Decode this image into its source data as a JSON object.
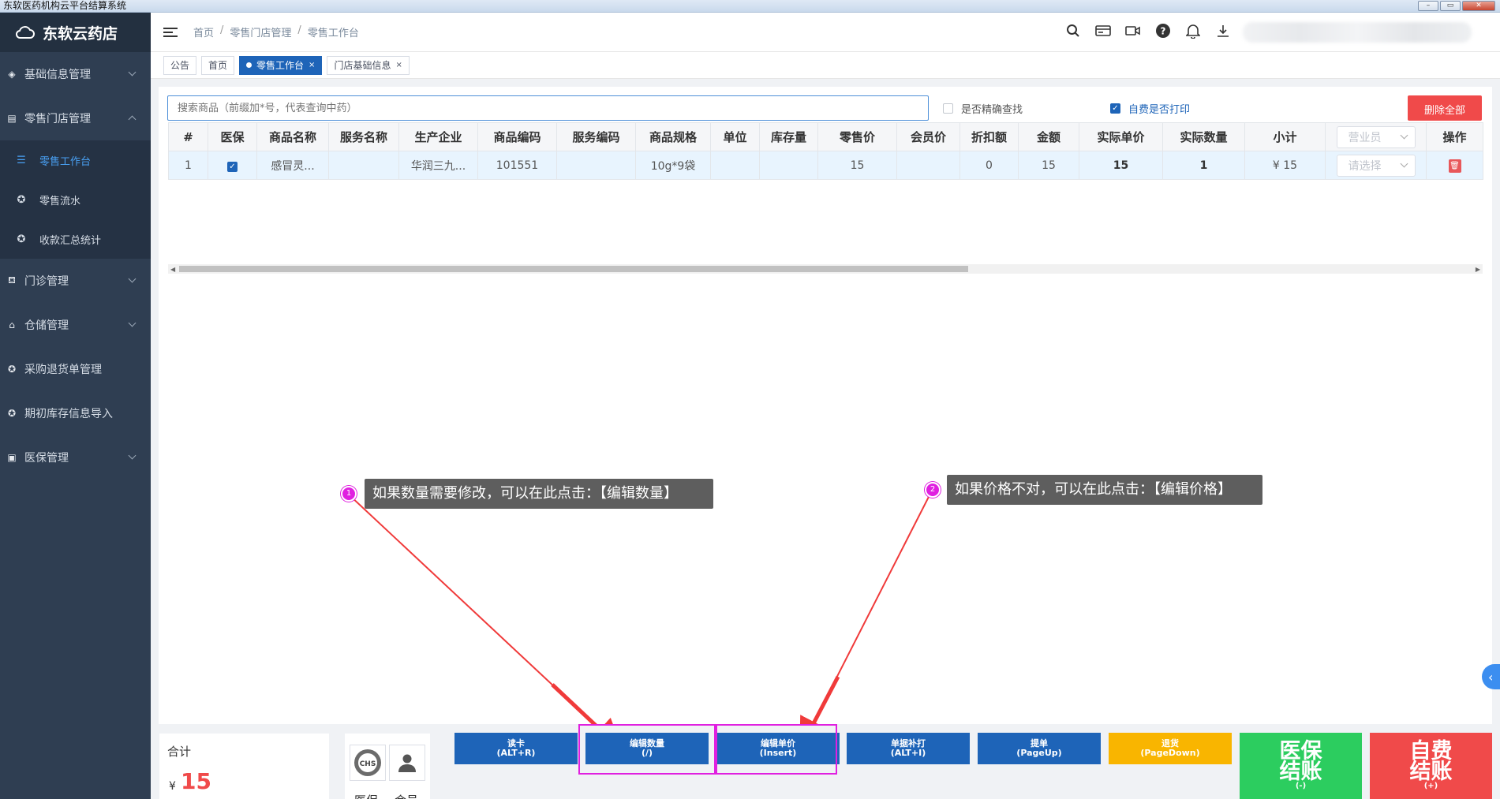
{
  "window": {
    "title": "东软医药机构云平台结算系统"
  },
  "app": {
    "name": "东软云药店"
  },
  "sidebar": {
    "items": [
      {
        "label": "基础信息管理",
        "icon": "layers-icon"
      },
      {
        "label": "零售门店管理",
        "icon": "store-icon",
        "expanded": true,
        "children": [
          {
            "label": "零售工作台",
            "active": true
          },
          {
            "label": "零售流水"
          },
          {
            "label": "收款汇总统计"
          }
        ]
      },
      {
        "label": "门诊管理",
        "icon": "clinic-icon"
      },
      {
        "label": "仓储管理",
        "icon": "warehouse-icon"
      },
      {
        "label": "采购退货单管理",
        "icon": "return-icon"
      },
      {
        "label": "期初库存信息导入",
        "icon": "import-icon"
      },
      {
        "label": "医保管理",
        "icon": "insurance-card-icon"
      }
    ]
  },
  "breadcrumb": [
    "首页",
    "零售门店管理",
    "零售工作台"
  ],
  "tabs": [
    {
      "label": "公告"
    },
    {
      "label": "首页"
    },
    {
      "label": "零售工作台",
      "active": true,
      "close": "×"
    },
    {
      "label": "门店基础信息",
      "close": "×"
    }
  ],
  "search": {
    "placeholder": "搜索商品（前缀加*号，代表查询中药）"
  },
  "options": {
    "exact_search": "是否精确查找",
    "self_pay_print": "自费是否打印"
  },
  "delete_all": "删除全部",
  "table": {
    "headers": [
      "#",
      "医保",
      "商品名称",
      "服务名称",
      "生产企业",
      "商品编码",
      "服务编码",
      "商品规格",
      "单位",
      "库存量",
      "零售价",
      "会员价",
      "折扣额",
      "金额",
      "实际单价",
      "实际数量",
      "小计",
      "",
      "操作"
    ],
    "salesperson_placeholder": "营业员",
    "row_select_placeholder": "请选择",
    "rows": [
      {
        "index": "1",
        "name": "感冒灵...",
        "service": "",
        "maker": "华润三九...",
        "code": "101551",
        "service_code": "",
        "spec": "10g*9袋",
        "unit": "",
        "stock": "",
        "retail": "15",
        "member": "",
        "discount": "0",
        "amount": "15",
        "actual_price": "15",
        "actual_qty": "1",
        "subtotal": "¥ 15"
      }
    ]
  },
  "annotations": [
    {
      "num": "1",
      "text": "如果数量需要修改，可以在此点击：【编辑数量】"
    },
    {
      "num": "2",
      "text": "如果价格不对，可以在此点击：【编辑价格】"
    }
  ],
  "summary": {
    "label": "合计",
    "currency": "¥",
    "amount": "15"
  },
  "member_panel": {
    "insurance_label": "医保",
    "member_label": "会员",
    "chs_text": "CHS"
  },
  "actions": [
    {
      "label": "读卡",
      "key": "(ALT+R)",
      "color": "#1e64b8"
    },
    {
      "label": "编辑数量",
      "key": "(/)",
      "color": "#1e64b8"
    },
    {
      "label": "编辑单价",
      "key": "(Insert)",
      "color": "#1e64b8"
    },
    {
      "label": "单据补打",
      "key": "(ALT+I)",
      "color": "#1e64b8"
    },
    {
      "label": "提单",
      "key": "(PageUp)",
      "color": "#1e64b8"
    },
    {
      "label": "退货",
      "key": "(PageDown)",
      "color": "#f9b500"
    }
  ],
  "checkout": {
    "insurance": {
      "line1": "医保",
      "line2": "结账",
      "key": "(-)",
      "color": "#2ccd5f"
    },
    "self_pay": {
      "line1": "自费",
      "line2": "结账",
      "key": "(+)",
      "color": "#f04a4a"
    }
  },
  "colors": {
    "primary": "#1e64b8",
    "danger": "#f04a4a",
    "annotation": "#e020e0",
    "sidebar": "#2f3e52"
  }
}
